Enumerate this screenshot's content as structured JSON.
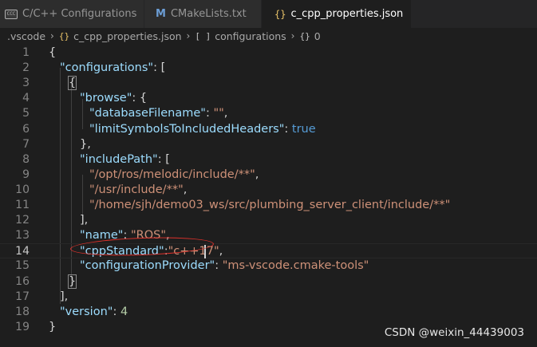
{
  "tabs": [
    {
      "label": "C/C++ Configurations",
      "icon": "c-cpp-config-icon",
      "active": false
    },
    {
      "label": "CMakeLists.txt",
      "icon": "cmake-icon",
      "active": false
    },
    {
      "label": "c_cpp_properties.json",
      "icon": "json-braces-icon",
      "active": true,
      "dirty": true
    }
  ],
  "breadcrumb": {
    "folder": ".vscode",
    "file_icon": "{}",
    "file": "c_cpp_properties.json",
    "array_icon": "[ ]",
    "array": "configurations",
    "object_icon": "{}",
    "object": "0"
  },
  "editor": {
    "active_line": 14,
    "lines": [
      {
        "n": "1",
        "tokens": [
          {
            "t": "punc",
            "v": "{"
          }
        ]
      },
      {
        "n": "2",
        "tokens": [
          {
            "t": "key",
            "v": "\"configurations\""
          },
          {
            "t": "punc",
            "v": ": ["
          }
        ]
      },
      {
        "n": "3",
        "tokens": [
          {
            "t": "punc",
            "v": "{"
          }
        ]
      },
      {
        "n": "4",
        "tokens": [
          {
            "t": "key",
            "v": "\"browse\""
          },
          {
            "t": "punc",
            "v": ": {"
          }
        ]
      },
      {
        "n": "5",
        "tokens": [
          {
            "t": "key",
            "v": "\"databaseFilename\""
          },
          {
            "t": "punc",
            "v": ": "
          },
          {
            "t": "str",
            "v": "\"\""
          },
          {
            "t": "punc",
            "v": ","
          }
        ]
      },
      {
        "n": "6",
        "tokens": [
          {
            "t": "key",
            "v": "\"limitSymbolsToIncludedHeaders\""
          },
          {
            "t": "punc",
            "v": ": "
          },
          {
            "t": "bool",
            "v": "true"
          }
        ]
      },
      {
        "n": "7",
        "tokens": [
          {
            "t": "punc",
            "v": "},"
          }
        ]
      },
      {
        "n": "8",
        "tokens": [
          {
            "t": "key",
            "v": "\"includePath\""
          },
          {
            "t": "punc",
            "v": ": ["
          }
        ]
      },
      {
        "n": "9",
        "tokens": [
          {
            "t": "str",
            "v": "\"/opt/ros/melodic/include/**\""
          },
          {
            "t": "punc",
            "v": ","
          }
        ]
      },
      {
        "n": "10",
        "tokens": [
          {
            "t": "str",
            "v": "\"/usr/include/**\""
          },
          {
            "t": "punc",
            "v": ","
          }
        ]
      },
      {
        "n": "11",
        "tokens": [
          {
            "t": "str",
            "v": "\"/home/sjh/demo03_ws/src/plumbing_server_client/include/**\""
          }
        ]
      },
      {
        "n": "12",
        "tokens": [
          {
            "t": "punc",
            "v": "],"
          }
        ]
      },
      {
        "n": "13",
        "tokens": [
          {
            "t": "key",
            "v": "\"name\""
          },
          {
            "t": "punc",
            "v": ": "
          },
          {
            "t": "str",
            "v": "\"ROS\""
          },
          {
            "t": "punc",
            "v": ","
          }
        ]
      },
      {
        "n": "14",
        "tokens": [
          {
            "t": "key",
            "v": "\"cppStandard\""
          },
          {
            "t": "punc",
            "v": ":"
          },
          {
            "t": "str",
            "v": "\"c++17\""
          },
          {
            "t": "punc",
            "v": ","
          }
        ]
      },
      {
        "n": "15",
        "tokens": [
          {
            "t": "key",
            "v": "\"configurationProvider\""
          },
          {
            "t": "punc",
            "v": ": "
          },
          {
            "t": "str",
            "v": "\"ms-vscode.cmake-tools\""
          }
        ]
      },
      {
        "n": "16",
        "tokens": [
          {
            "t": "punc",
            "v": "}"
          }
        ]
      },
      {
        "n": "17",
        "tokens": [
          {
            "t": "punc",
            "v": "],"
          }
        ]
      },
      {
        "n": "18",
        "tokens": [
          {
            "t": "key",
            "v": "\"version\""
          },
          {
            "t": "punc",
            "v": ": "
          },
          {
            "t": "num",
            "v": "4"
          }
        ]
      },
      {
        "n": "19",
        "tokens": [
          {
            "t": "punc",
            "v": "}"
          }
        ]
      }
    ]
  },
  "watermark": "CSDN @weixin_44439003",
  "colors": {
    "background": "#1e1e1e",
    "key": "#9cdcfe",
    "string": "#ce9178",
    "keyword": "#569cd6",
    "number": "#b5cea8",
    "annotation": "#e0312b"
  }
}
